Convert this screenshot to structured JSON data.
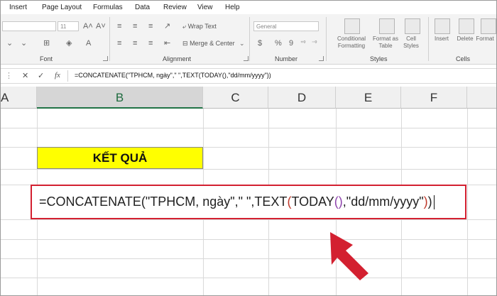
{
  "menu": [
    "Insert",
    "Page Layout",
    "Formulas",
    "Data",
    "Review",
    "View",
    "Help"
  ],
  "ribbon": {
    "font_size": "11",
    "font_group_label": "Font",
    "alignment_group_label": "Alignment",
    "wrap_text_label": "Wrap Text",
    "merge_center_label": "Merge & Center",
    "number_format": "General",
    "number_group_label": "Number",
    "conditional_formatting_label": [
      "Conditional",
      "Formatting"
    ],
    "format_as_table_label": [
      "Format as",
      "Table"
    ],
    "cell_styles_label": [
      "Cell",
      "Styles"
    ],
    "styles_group_label": "Styles",
    "insert_label": "Insert",
    "delete_label": "Delete",
    "format_label": "Format",
    "cells_group_label": "Cells"
  },
  "formula_bar": {
    "cancel": "✕",
    "enter": "✓",
    "fx": "fx",
    "formula": "=CONCATENATE(\"TPHCM, ngày\",\" \",TEXT(TODAY(),\"dd/mm/yyyy\"))"
  },
  "columns": [
    "A",
    "B",
    "C",
    "D",
    "E",
    "F"
  ],
  "result_label": "KẾT QUẢ",
  "formula_display": {
    "part1": "=CONCATENATE(\"TPHCM, ngày\",\" \",TEXT",
    "open_text": "(",
    "part2": "TODAY",
    "today_parens": "()",
    "part3": ",\"dd/mm/yyyy\"",
    "close_text": ")",
    "close_concat": ")"
  },
  "colors": {
    "accent_green": "#217346",
    "highlight_yellow": "#ffff00",
    "annotation_red": "#d32030"
  }
}
